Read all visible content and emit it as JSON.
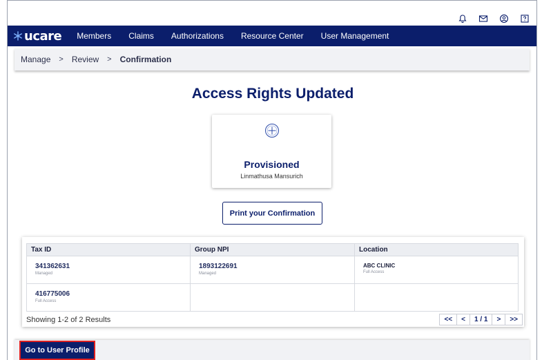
{
  "header": {
    "icons": [
      "bell-icon",
      "mail-icon",
      "account-icon",
      "help-icon"
    ]
  },
  "nav": {
    "logo_text": "ucare",
    "items": [
      "Members",
      "Claims",
      "Authorizations",
      "Resource Center",
      "User Management"
    ]
  },
  "breadcrumb": {
    "items": [
      "Manage",
      "Review",
      "Confirmation"
    ],
    "separator": ">"
  },
  "page": {
    "title": "Access Rights Updated"
  },
  "card": {
    "icon": "plus-circle-icon",
    "status": "Provisioned",
    "name": "Linmathusa Mansurich"
  },
  "print_button": {
    "label": "Print your Confirmation"
  },
  "table": {
    "columns": [
      "Tax ID",
      "Group NPI",
      "Location"
    ],
    "rows": [
      [
        {
          "value": "341362631",
          "sub": "Managed"
        },
        {
          "value": "1893122691",
          "sub": "Managed"
        },
        {
          "value": "ABC CLINIC",
          "sub": "Full Access"
        }
      ],
      [
        {
          "value": "416775006",
          "sub": "Full Access"
        },
        {
          "value": "",
          "sub": ""
        },
        {
          "value": "",
          "sub": ""
        }
      ]
    ],
    "results_text": "Showing 1-2 of 2 Results",
    "pager": {
      "first": "<<",
      "prev": "<",
      "page": "1 / 1",
      "next": ">",
      "last": ">>"
    }
  },
  "profile_button": {
    "label": "Go to User Profile"
  },
  "colors": {
    "brand_navy": "#0b1e6b",
    "highlight_red": "#e02020"
  }
}
